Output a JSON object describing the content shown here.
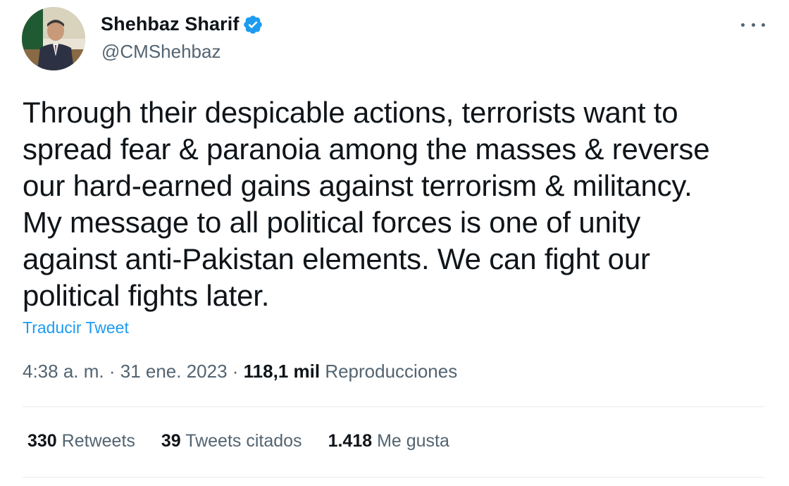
{
  "author": {
    "display_name": "Shehbaz Sharif",
    "handle": "@CMShehbaz",
    "verified": true
  },
  "tweet": {
    "text": "Through their despicable actions, terrorists want to\nspread fear & paranoia among the masses & reverse\nour hard-earned gains against terrorism & militancy.\nMy message to all political forces is one of unity\nagainst anti-Pakistan elements. We can fight our\npolitical fights later.",
    "translate_label": "Traducir Tweet"
  },
  "meta": {
    "time": "4:38 a. m.",
    "sep1": " · ",
    "date": "31 ene. 2023",
    "sep2": " · ",
    "views_count": "118,1 mil",
    "views_label": "Reproducciones"
  },
  "stats": {
    "retweets_count": "330",
    "retweets_label": "Retweets",
    "quotes_count": "39",
    "quotes_label": "Tweets citados",
    "likes_count": "1.418",
    "likes_label": "Me gusta"
  },
  "colors": {
    "link": "#1d9bf0",
    "secondary_text": "#536471",
    "primary_text": "#0f1419",
    "divider": "#e6ecf0"
  },
  "icons": {
    "verified": "verified-badge-icon",
    "more": "more-horizontal-icon"
  }
}
